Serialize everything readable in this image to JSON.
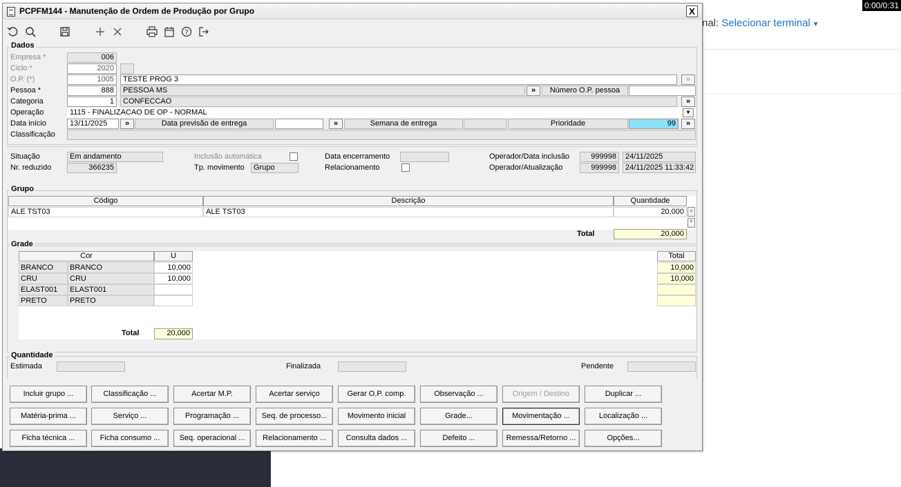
{
  "timer": "0:00/0:31",
  "background": {
    "terminal_prefix": "nal: ",
    "terminal_link": "Selecionar terminal"
  },
  "window": {
    "title": "PCPFM144 - Manutenção de Ordem de Produção por Grupo",
    "close": "X"
  },
  "toolbar": [
    "undo-icon",
    "search-icon",
    "save-icon",
    "add-icon",
    "delete-icon",
    "print-icon",
    "calendar-icon",
    "help-icon",
    "exit-icon"
  ],
  "dados": {
    "section": "Dados",
    "empresa_label": "Empresa *",
    "empresa": "006",
    "ciclo_label": "Ciclo *",
    "ciclo": "2020",
    "op_label": "O.P. (*)",
    "op": "1005",
    "op_desc": "TESTE PROG 3",
    "pessoa_label": "Pessoa *",
    "pessoa": "888",
    "pessoa_desc": "PESSOA MS",
    "numero_op_pessoa_label": "Número O.P. pessoa",
    "numero_op_pessoa": "",
    "categoria_label": "Categoria",
    "categoria": "1",
    "categoria_desc": "CONFECCAO",
    "operacao_label": "Operação",
    "operacao": "1115 - FINALIZACAO DE OP - NORMAL",
    "data_inicio_label": "Data início",
    "data_inicio": "13/11/2025",
    "data_previsao_label": "Data previsão de entrega",
    "data_previsao": "",
    "semana_label": "Semana de entrega",
    "semana": "",
    "prioridade_label": "Prioridade",
    "prioridade": "99",
    "classificacao_label": "Classificação",
    "classificacao": "",
    "lookup": "»"
  },
  "status": {
    "situacao_label": "Situação",
    "situacao": "Em andamento",
    "nr_reduzido_label": "Nr. reduzido",
    "nr_reduzido": "366235",
    "inclusao_label": "Inclusão automática",
    "tp_mov_label": "Tp. movimento",
    "tp_mov": "Grupo",
    "data_enc_label": "Data encerramento",
    "data_enc": "",
    "relacionamento_label": "Relacionamento",
    "op_data_inclusao_label": "Operador/Data inclusão",
    "op_inclusao": "999998",
    "data_inclusao": "24/11/2025",
    "op_atualizacao_label": "Operador/Atualização",
    "op_atualizacao": "999998",
    "data_atualizacao": "24/11/2025 11:33:42"
  },
  "grupo": {
    "section": "Grupo",
    "headers": {
      "codigo": "Código",
      "descricao": "Descrição",
      "quantidade": "Quantidade"
    },
    "rows": [
      {
        "codigo": "ALE TST03",
        "descricao": "ALE TST03",
        "quantidade": "20,000"
      }
    ],
    "total_label": "Total",
    "total": "20,000"
  },
  "grade": {
    "section": "Grade",
    "headers": {
      "cor": "Cor",
      "u": "U",
      "total": "Total"
    },
    "rows": [
      {
        "code": "BRANCO",
        "name": "BRANCO",
        "u": "10,000",
        "total": "10,000"
      },
      {
        "code": "CRU",
        "name": "CRU",
        "u": "10,000",
        "total": "10,000"
      },
      {
        "code": "ELAST001",
        "name": "ELAST001",
        "u": "",
        "total": ""
      },
      {
        "code": "PRETO",
        "name": "PRETO",
        "u": "",
        "total": ""
      }
    ],
    "total_label": "Total",
    "total": "20,000"
  },
  "quantidade": {
    "section": "Quantidade",
    "estimada_label": "Estimada",
    "estimada": "",
    "finalizada_label": "Finalizada",
    "finalizada": "",
    "pendente_label": "Pendente",
    "pendente": ""
  },
  "buttons": [
    [
      "Incluir grupo ...",
      "Classificação ...",
      "Acertar M.P.",
      "Acertar serviço",
      "Gerar O.P. comp.",
      "Observação ...",
      "Origem / Destino",
      "Duplicar ..."
    ],
    [
      "Matéria-prima ...",
      "Serviço ...",
      "Programação ...",
      "Seq. de processo...",
      "Movimento inicial",
      "Grade...",
      "Movimentação ...",
      "Localização ..."
    ],
    [
      "Ficha técnica ...",
      "Ficha consumo ...",
      "Seq. operacional ...",
      "Relacionamento ...",
      "Consulta dados ...",
      "Defeito ...",
      "Remessa/Retorno ...",
      "Opções..."
    ]
  ]
}
